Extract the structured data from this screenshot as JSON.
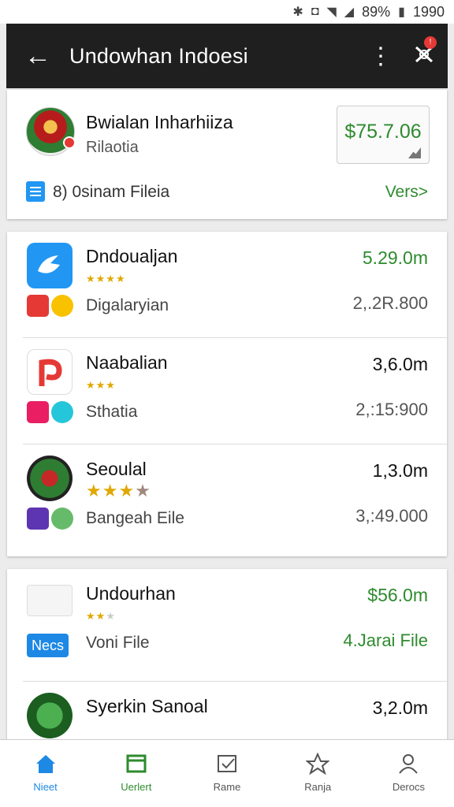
{
  "status_bar": {
    "battery": "89%",
    "time": "1990"
  },
  "toolbar": {
    "title": "Undowhan Indoesi"
  },
  "featured": {
    "title": "Bwialan Inharhiiza",
    "subtitle": "Rilaotia",
    "price": "$75.7.06",
    "file_label": "8) 0sinam Fileia",
    "vers_label": "Vers>"
  },
  "list1": [
    {
      "name": "Dndoualjan",
      "amount": "5.29.0m",
      "sub": "Digalaryian",
      "count": "2,.2R.800"
    },
    {
      "name": "Naabalian",
      "amount": "3,6.0m",
      "sub": "Sthatia",
      "count": "2,:15:900"
    },
    {
      "name": "Seoulal",
      "amount": "1,3.0m",
      "sub": "Bangeah Eile",
      "count": "3,:49.000"
    }
  ],
  "list2": [
    {
      "name": "Undourhan",
      "amount": "$56.0m",
      "tag": "Necs",
      "sub": "Voni File",
      "right": "4.Jarai File"
    },
    {
      "name": "Syerkin Sanoal",
      "amount": "3,2.0m"
    }
  ],
  "tabs": [
    {
      "label": "Nieet"
    },
    {
      "label": "Uerlert"
    },
    {
      "label": "Rame"
    },
    {
      "label": "Ranja"
    },
    {
      "label": "Derocs"
    }
  ],
  "colors": {
    "green": "#2e8b2e",
    "blue": "#1e88e5",
    "toolbar": "#1f1f1f"
  }
}
